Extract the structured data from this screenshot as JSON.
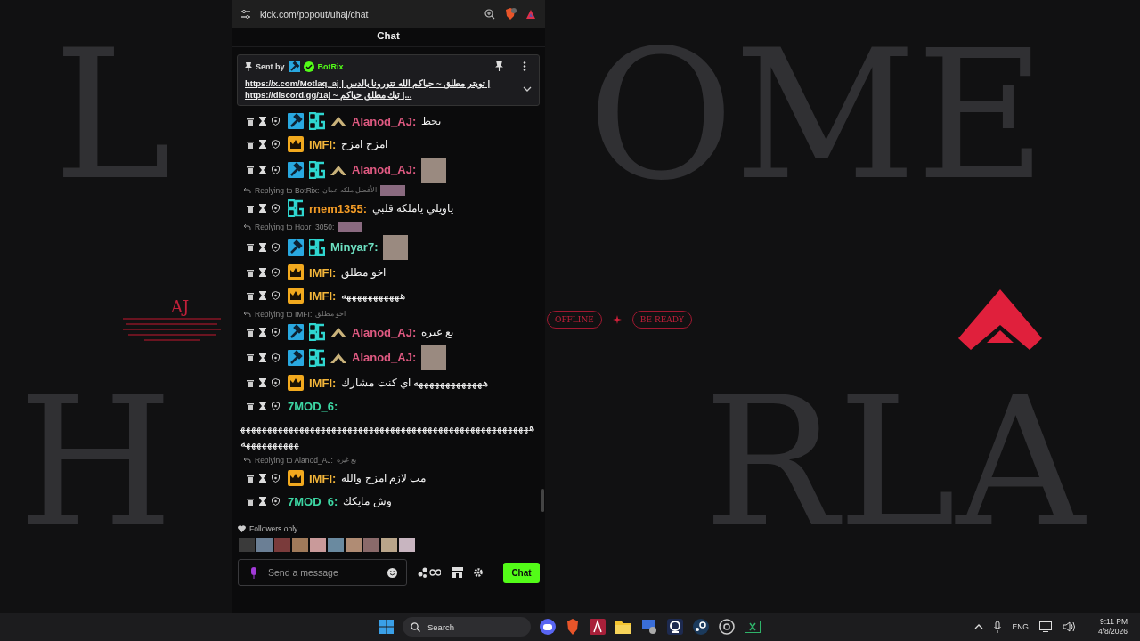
{
  "desktop": {
    "letters_top_left": "L",
    "letters_top_right": "OME",
    "letters_bottom_left": "H",
    "letters_bottom_right": "RLA",
    "left_title": "AJ",
    "status_pill": "OFFLINE",
    "ready_pill": "BE READY"
  },
  "browser": {
    "url": "kick.com/popout/uhaj/chat"
  },
  "chat": {
    "title": "Chat",
    "pinned": {
      "sent_by": "Sent by",
      "author": "BotRix",
      "lines": [
        "https://x.com/Motlaq_aj | تويتر مطلق ~ حياكم الله تتورونا بالدس |",
        "https://discord.gg/1aj ~ تيك مطلق حياكم |..."
      ]
    },
    "messages": [
      {
        "user": "Alanod_AJ:",
        "color": "#e05a82",
        "badges": [
          {
            "kind": "mod"
          },
          {
            "kind": "og"
          },
          {
            "kind": "chevron"
          }
        ],
        "text": "بحط"
      },
      {
        "user": "IMFI:",
        "color": "#f2b53a",
        "badges": [
          {
            "kind": "crown"
          }
        ],
        "text": "امزح امزح"
      },
      {
        "user": "Alanod_AJ:",
        "color": "#e05a82",
        "badges": [
          {
            "kind": "mod"
          },
          {
            "kind": "og"
          },
          {
            "kind": "chevron"
          }
        ],
        "emote": true
      },
      {
        "reply": {
          "label": "Replying to BotRix:",
          "text": "الأفضل ملكه عمان",
          "image": true
        },
        "user": "rnem1355:",
        "color": "#f29b26",
        "badges": [
          {
            "kind": "og"
          }
        ],
        "text": "ياويلي ياملكه قلبي"
      },
      {
        "reply": {
          "label": "Replying to Hoor_3050:",
          "image": true
        },
        "user": "Minyar7:",
        "color": "#6de0c2",
        "badges": [
          {
            "kind": "mod"
          },
          {
            "kind": "og"
          }
        ],
        "emote": true
      },
      {
        "user": "IMFI:",
        "color": "#f2b53a",
        "badges": [
          {
            "kind": "crown"
          }
        ],
        "text": "اخو مطلق"
      },
      {
        "user": "IMFI:",
        "color": "#f2b53a",
        "badges": [
          {
            "kind": "crown"
          }
        ],
        "text": "هههههههههههه"
      },
      {
        "reply": {
          "label": "Replying to IMFI:",
          "text": "اخو مطلق"
        },
        "user": "Alanod_AJ:",
        "color": "#e05a82",
        "badges": [
          {
            "kind": "mod"
          },
          {
            "kind": "og"
          },
          {
            "kind": "chevron"
          }
        ],
        "text": "يع غيره"
      },
      {
        "user": "Alanod_AJ:",
        "color": "#e05a82",
        "badges": [
          {
            "kind": "mod"
          },
          {
            "kind": "og"
          },
          {
            "kind": "chevron"
          }
        ],
        "emote": true
      },
      {
        "user": "IMFI:",
        "color": "#f2b53a",
        "badges": [
          {
            "kind": "crown"
          }
        ],
        "text": "هههههههههههههه اي كنت مشارك"
      },
      {
        "user": "7MOD_6:",
        "color": "#3dd6a3",
        "block_text": "هههههههههههههههههههههههههههههههههههههههههههههههههههههههههههههههههه"
      },
      {
        "reply": {
          "label": "Replying to Alanod_AJ:",
          "text": "يع غيره"
        },
        "user": "IMFI:",
        "color": "#f2b53a",
        "badges": [
          {
            "kind": "crown"
          }
        ],
        "text": "مب لازم امزح والله"
      },
      {
        "user": "7MOD_6:",
        "color": "#3dd6a3",
        "text": "وش مايكك"
      }
    ],
    "followers_only": "Followers only",
    "emote_strip": [
      {
        "color": "#3a3a3a"
      },
      {
        "color": "#6b7f95"
      },
      {
        "color": "#7a3b3b"
      },
      {
        "color": "#a07a5a"
      },
      {
        "color": "#c99a9a"
      },
      {
        "color": "#6a8aa0"
      },
      {
        "color": "#b08c74"
      },
      {
        "color": "#8a6a6a"
      },
      {
        "color": "#b9a58a"
      },
      {
        "color": "#c8b5c0"
      }
    ],
    "input": {
      "placeholder": "Send a message"
    },
    "send_button": "Chat"
  },
  "taskbar": {
    "search": "Search",
    "language": "ENG",
    "time": "9:11 PM",
    "date": "4/8/2026"
  }
}
